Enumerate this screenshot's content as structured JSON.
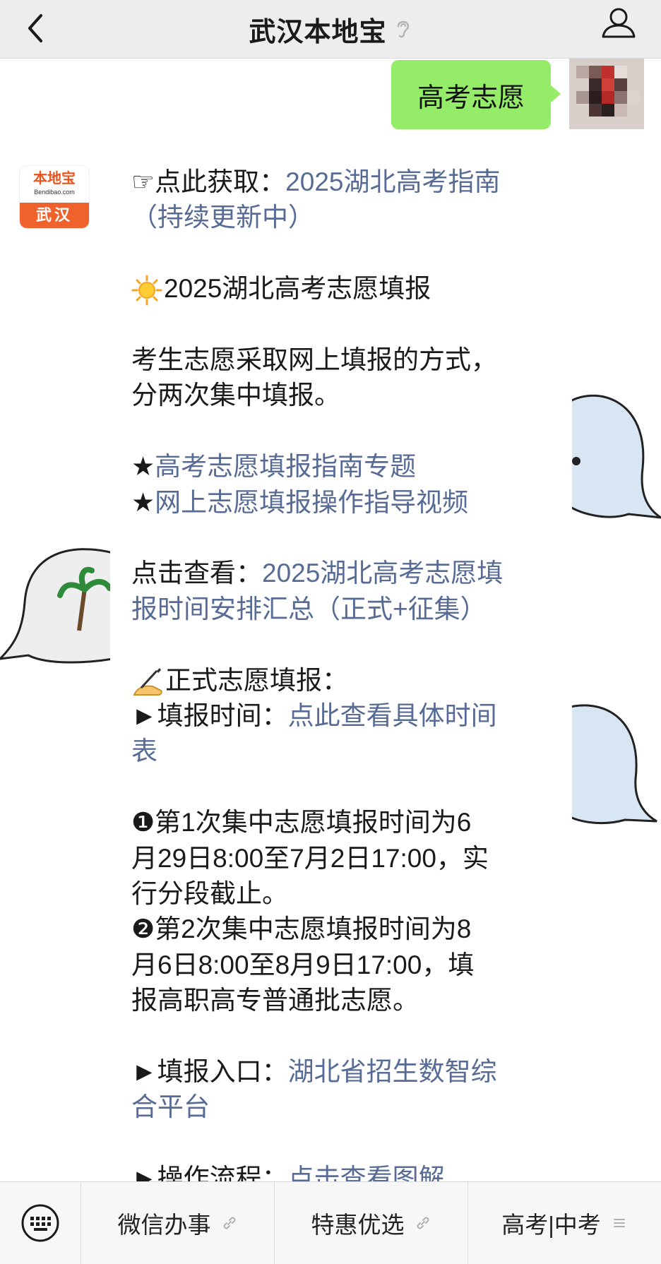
{
  "header": {
    "title": "武汉本地宝"
  },
  "chat": {
    "user_message": "高考志愿",
    "bot_avatar": {
      "logo_text": "本地宝",
      "logo_sub": "Bendibao.com",
      "city": "武汉"
    },
    "message": {
      "l1_prefix": "☞点此获取：",
      "l1_link_a": "2025湖北高考指南",
      "l1_link_b": "（持续更新中）",
      "l2_text": "2025湖北高考志愿填报",
      "l3_a": "考生志愿采取网上填报的方式，",
      "l3_b": "分两次集中填报。",
      "star1_prefix": "★",
      "star1_link": "高考志愿填报指南专题",
      "star2_prefix": "★",
      "star2_link": "网上志愿填报操作指导视频",
      "view_prefix": "点击查看：",
      "view_link_a": "2025湖北高考志愿填",
      "view_link_b": "报时间安排汇总（正式+征集）",
      "formal_title": "正式志愿填报：",
      "time_prefix": "►填报时间：",
      "time_link_a": "点此查看具体时间",
      "time_link_b": "表",
      "first_a": "❶第1次集中志愿填报时间为6",
      "first_b": "月29日8:00至7月2日17:00，实",
      "first_c": "行分段截止。",
      "second_a": "❷第2次集中志愿填报时间为8",
      "second_b": "月6日8:00至8月9日17:00，填",
      "second_c": "报高职高专普通批志愿。",
      "entry_prefix": "►填报入口：",
      "entry_link_a": "湖北省招生数智综",
      "entry_link_b": "合平台",
      "cut_text": "►操作流程：",
      "cut_link": "点击查看图解"
    }
  },
  "bottom_menu": {
    "items": [
      "微信办事",
      "特惠优选",
      "高考|中考"
    ]
  },
  "colors": {
    "link": "#576b95",
    "user_bubble": "#95ec69",
    "brand_orange": "#f0622c"
  }
}
